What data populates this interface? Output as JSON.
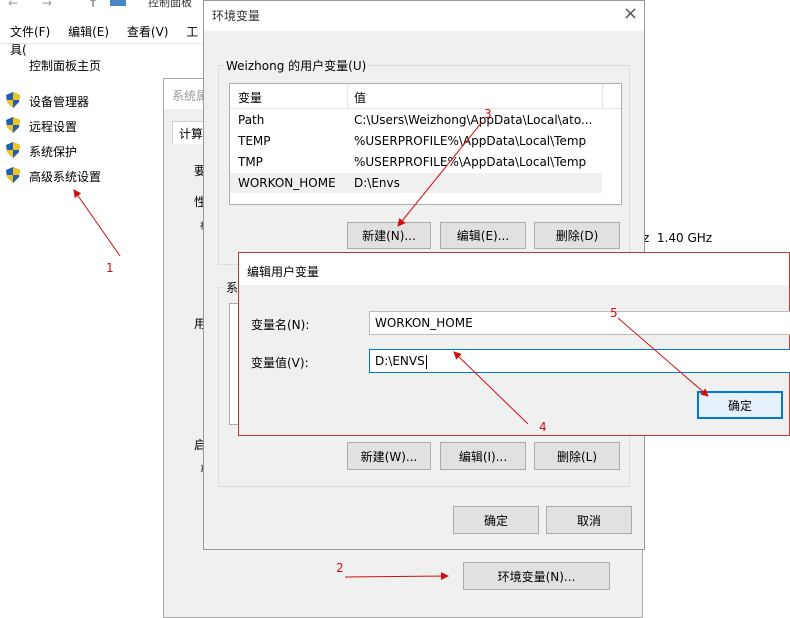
{
  "explorer": {
    "menu": [
      "文件(F)",
      "编辑(E)",
      "查看(V)",
      "工具("
    ],
    "address_text": "控制面板",
    "sidebar_home": "控制面板主页",
    "sidebar_items": [
      "设备管理器",
      "远程设置",
      "系统保护",
      "高级系统设置"
    ],
    "cpu_fragment": "z  1.40 GHz"
  },
  "sysprops": {
    "title": "系统属",
    "tab": "计算",
    "frag_a": "要",
    "frag_b": "性",
    "frag_c": "视",
    "frag_d": "系",
    "frag_e": "用",
    "frag_f": "启",
    "frag_g": "系",
    "env_button": "环境变量(N)..."
  },
  "envvars": {
    "title": "环境变量",
    "user_group": "Weizhong 的用户变量(U)",
    "col_var": "变量",
    "col_val": "值",
    "rows": [
      {
        "name": "Path",
        "value": "C:\\Users\\Weizhong\\AppData\\Local\\ato..."
      },
      {
        "name": "TEMP",
        "value": "%USERPROFILE%\\AppData\\Local\\Temp"
      },
      {
        "name": "TMP",
        "value": "%USERPROFILE%\\AppData\\Local\\Temp"
      },
      {
        "name": "WORKON_HOME",
        "value": "D:\\Envs"
      }
    ],
    "new_user": "新建(N)...",
    "edit_user": "编辑(E)...",
    "delete_user": "删除(D)",
    "sys_group_frag": "系",
    "new_sys": "新建(W)...",
    "edit_sys": "编辑(I)...",
    "delete_sys": "删除(L)",
    "ok": "确定",
    "cancel": "取消"
  },
  "editdlg": {
    "title": "编辑用户变量",
    "name_label": "变量名(N):",
    "value_label": "变量值(V):",
    "name_value": "WORKON_HOME",
    "value_value": "D:\\ENVS",
    "ok": "确定"
  },
  "annotations": [
    "1",
    "2",
    "3",
    "4",
    "5"
  ],
  "colors": {
    "annotation": "#d01010",
    "focus": "#0078d7"
  }
}
